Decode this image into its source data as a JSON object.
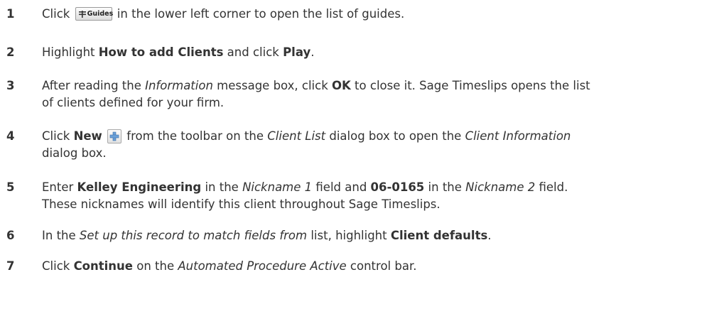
{
  "steps": [
    {
      "number": "1",
      "parts": {
        "a": "Click ",
        "guides_label": "Guides",
        "b": " in the lower left corner to open the list of guides."
      }
    },
    {
      "number": "2",
      "parts": {
        "a": "Highlight ",
        "b_bold": "How to add Clients",
        "c": " and click ",
        "d_bold": "Play",
        "e": "."
      }
    },
    {
      "number": "3",
      "parts": {
        "a": "After reading the ",
        "b_italic": "Information",
        "c": " message box, click ",
        "d_bold": "OK",
        "e": " to close it. Sage Timeslips opens the list",
        "line2": "of clients defined for your firm."
      }
    },
    {
      "number": "4",
      "parts": {
        "a": "Click ",
        "b_bold": "New",
        "c": " from the toolbar on the ",
        "d_italic": "Client List",
        "e": " dialog box to open the ",
        "f_italic": "Client Information",
        "line2": "dialog box."
      }
    },
    {
      "number": "5",
      "parts": {
        "a": "Enter ",
        "b_bold": "Kelley Engineering",
        "c": " in the ",
        "d_italic": "Nickname 1",
        "e": " field and ",
        "f_bold": "06-0165",
        "g": " in the ",
        "h_italic": "Nickname 2",
        "i": " field.",
        "line2": "These nicknames will identify this client throughout Sage Timeslips."
      }
    },
    {
      "number": "6",
      "parts": {
        "a": "In the ",
        "b_italic": "Set up this record to match fields from",
        "c": " list, highlight ",
        "d_bold": "Client defaults",
        "e": "."
      }
    },
    {
      "number": "7",
      "parts": {
        "a": "Click ",
        "b_bold": "Continue",
        "c": " on the ",
        "d_italic": "Automated Procedure Active",
        "e": " control bar."
      }
    }
  ],
  "icons": {
    "guides": "guides-icon",
    "new": "new-plus-icon"
  },
  "colors": {
    "text": "#333333",
    "new_icon_plus": "#6aa0d8"
  }
}
